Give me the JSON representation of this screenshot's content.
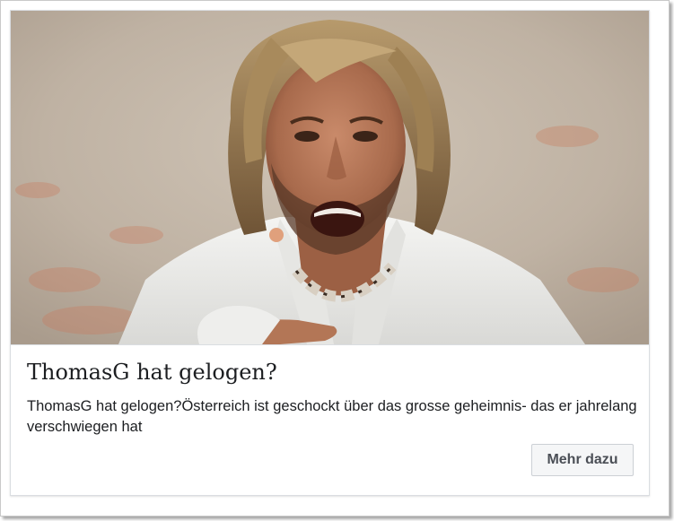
{
  "ad": {
    "headline": "ThomasG hat gelogen?",
    "description": "ThomasG hat gelogen?Österreich ist geschockt über das grosse geheimnis- das er jahrelang verschwiegen hat",
    "cta_label": "Mehr dazu"
  },
  "colors": {
    "text": "#1c1e21",
    "button_bg": "#f5f6f7",
    "button_text": "#4b4f56",
    "border": "#dadde1"
  }
}
